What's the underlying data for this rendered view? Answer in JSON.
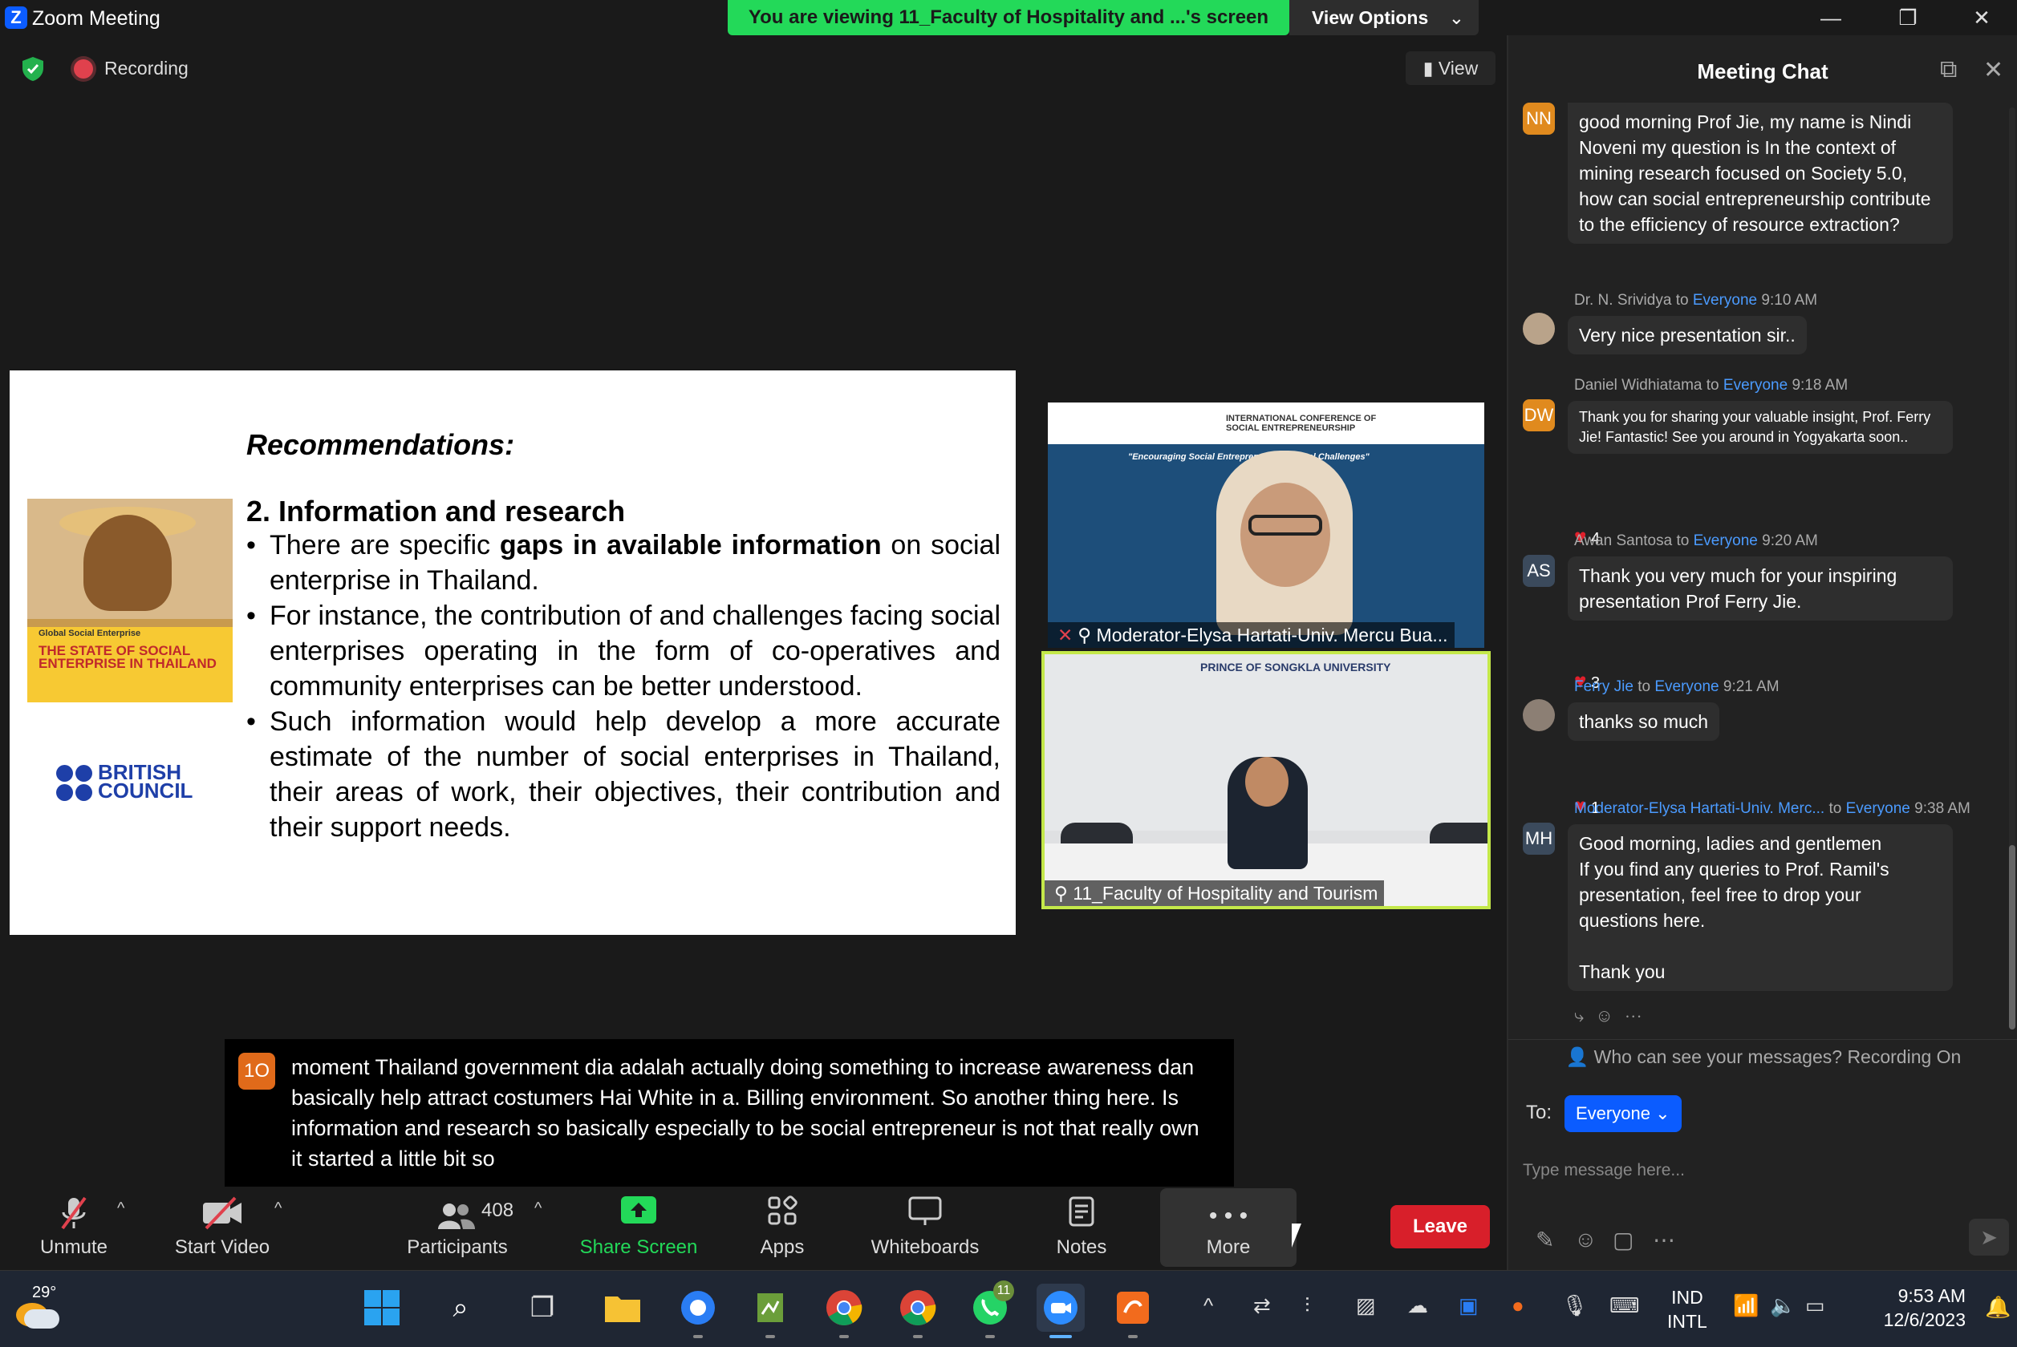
{
  "window": {
    "app_title": "Zoom Meeting",
    "share_banner": "You are viewing 11_Faculty of Hospitality and ...'s screen",
    "view_options_label": "View Options",
    "minimize_icon": "—",
    "restore_icon": "❐",
    "close_icon": "✕"
  },
  "status": {
    "recording_label": "Recording",
    "view_button_label": "View"
  },
  "slide": {
    "title": "Recommendations:",
    "heading": "2. Information and research",
    "bullet1_pre": "There are specific ",
    "bullet1_bold": "gaps in available information",
    "bullet1_post": " on social enterprise in Thailand.",
    "bullet2": "For instance, the contribution of and challenges facing social enterprises operating in the form of co-operatives and community enterprises can be better understood.",
    "bullet3": "Such information would help develop a more accurate estimate of the number of social enterprises in Thailand, their areas of work, their objectives, their contribution and their support needs.",
    "book_kicker": "Global Social Enterprise",
    "book_title": "THE STATE OF SOCIAL ENTERPRISE IN THAILAND",
    "logo_text_line1": "BRITISH",
    "logo_text_line2": "COUNCIL"
  },
  "videos": [
    {
      "label": "Moderator-Elysa Hartati-Univ. Mercu Bua...",
      "conference": "INTERNATIONAL CONFERENCE OF SOCIAL ENTREPRENEURSHIP",
      "motto": "\"Encouraging Social Entreprene...  ...e Global Challenges\""
    },
    {
      "label": "11_Faculty of Hospitality and Tourism",
      "backdrop_text": "PRINCE OF SONGKLA UNIVERSITY"
    }
  ],
  "caption": {
    "avatar_initials": "1O",
    "text": "moment Thailand government dia adalah actually doing something to increase awareness dan basically help attract costumers Hai White in a. Billing environment. So another thing here. Is information and research so basically especially to be social entrepreneur is not that really own it started a little bit so"
  },
  "toolbar": {
    "unmute_label": "Unmute",
    "start_video_label": "Start Video",
    "participants_label": "Participants",
    "participants_count": "408",
    "share_screen_label": "Share Screen",
    "apps_label": "Apps",
    "whiteboards_label": "Whiteboards",
    "notes_label": "Notes",
    "more_label": "More",
    "leave_label": "Leave"
  },
  "chat": {
    "title": "Meeting Chat",
    "messages": [
      {
        "initials": "NN",
        "avatar_color": "#e08a1e",
        "text": "good morning Prof Jie, my name is Nindi Noveni my question is In the context of mining research focused on Society 5.0, how can social entrepreneurship contribute to the efficiency of resource extraction?"
      },
      {
        "sender": "Dr. N. Srividya",
        "to_word": "to",
        "recipient": "Everyone",
        "time": "9:10 AM",
        "text": "Very nice presentation sir.."
      },
      {
        "initials": "DW",
        "avatar_color": "#e08a1e",
        "sender": "Daniel Widhiatama",
        "to_word": "to",
        "recipient": "Everyone",
        "time": "9:18 AM",
        "text": "Thank you for sharing your valuable insight, Prof. Ferry Jie! Fantastic! See you around in Yogyakarta soon..",
        "reaction_count": "4"
      },
      {
        "initials": "AS",
        "avatar_color": "#3b4a5c",
        "sender": "Awan Santosa",
        "to_word": "to",
        "recipient": "Everyone",
        "time": "9:20 AM",
        "text": "Thank you very much for your inspiring presentation Prof Ferry Jie.",
        "reaction_count": "3"
      },
      {
        "sender": "Ferry Jie",
        "to_word": "to",
        "recipient": "Everyone",
        "time": "9:21 AM",
        "text": "thanks so much",
        "reaction_count": "1"
      },
      {
        "initials": "MH",
        "avatar_color": "#3b4a5c",
        "sender": "Moderator-Elysa Hartati-Univ. Merc...",
        "to_word": "to",
        "recipient": "Everyone",
        "time": "9:38 AM",
        "text_line1": "Good morning, ladies and gentlemen",
        "text_line2": "If you find any queries to Prof. Ramil's presentation, feel free to drop your questions here.",
        "text_line3": "Thank you"
      }
    ],
    "visibility_note": "Who can see your messages? Recording On",
    "to_label": "To:",
    "to_value": "Everyone",
    "input_placeholder": "Type message here..."
  },
  "taskbar": {
    "temperature": "29°",
    "whatsapp_badge": "11",
    "language_line1": "IND",
    "language_line2": "INTL",
    "time": "9:53 AM",
    "date": "12/6/2023"
  },
  "colors": {
    "share_banner": "#23d959",
    "leave": "#d81f2a",
    "accent_blue": "#0b5cff",
    "tile_border": "#c4e84a",
    "recording": "#e0414d"
  }
}
